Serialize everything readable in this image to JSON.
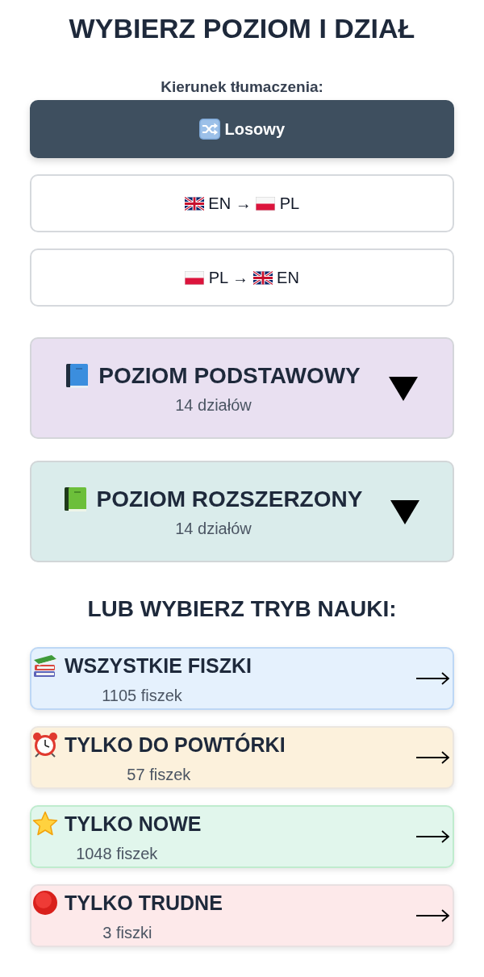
{
  "title": "WYBIERZ POZIOM I DZIAŁ",
  "direction": {
    "label": "Kierunek tłumaczenia:",
    "options": [
      {
        "kind": "random",
        "text": "Losowy",
        "selected": true
      },
      {
        "kind": "en_pl",
        "from": "EN",
        "arrow": "→",
        "to": "PL",
        "selected": false
      },
      {
        "kind": "pl_en",
        "from": "PL",
        "arrow": "→",
        "to": "EN",
        "selected": false
      }
    ]
  },
  "levels": [
    {
      "kind": "basic",
      "title": "POZIOM PODSTAWOWY",
      "count": "14 działów"
    },
    {
      "kind": "extended",
      "title": "POZIOM ROZSZERZONY",
      "count": "14 działów"
    }
  ],
  "modes": {
    "heading": "LUB WYBIERZ TRYB NAUKI:",
    "items": [
      {
        "kind": "all",
        "title": "WSZYSTKIE FISZKI",
        "count": "1105 fiszek"
      },
      {
        "kind": "review",
        "title": "TYLKO DO POWTÓRKI",
        "count": "57 fiszek"
      },
      {
        "kind": "new",
        "title": "TYLKO NOWE",
        "count": "1048 fiszek"
      },
      {
        "kind": "hard",
        "title": "TYLKO TRUDNE",
        "count": "3 fiszki"
      }
    ]
  }
}
